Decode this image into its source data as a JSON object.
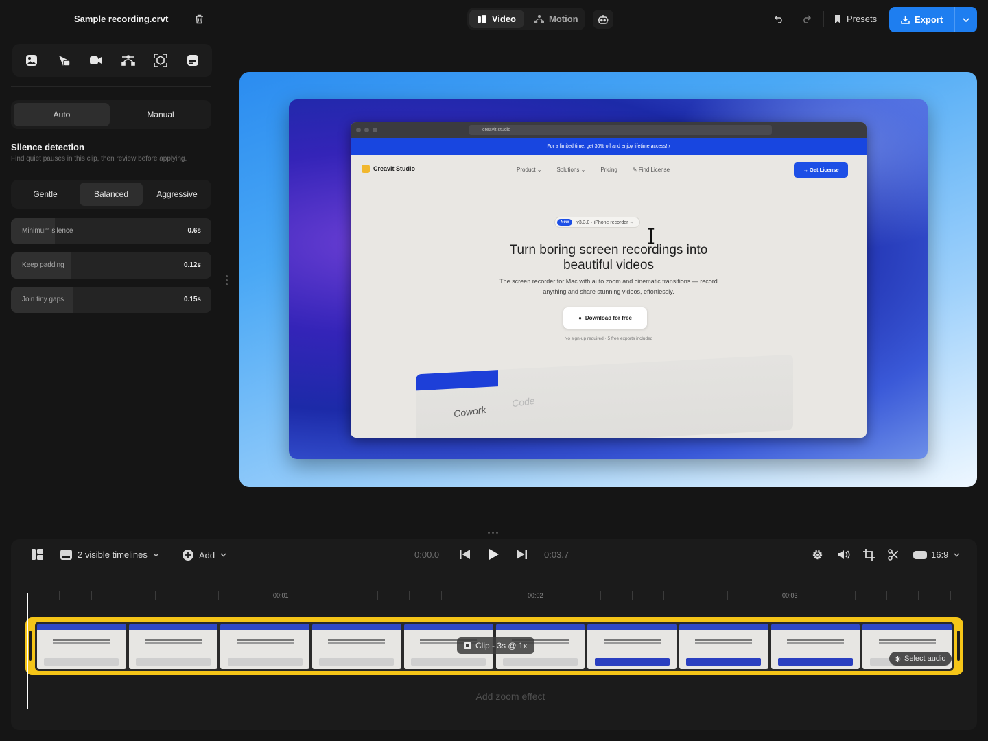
{
  "header": {
    "file_name": "Sample recording.crvt",
    "modes": [
      {
        "label": "Video",
        "active": true
      },
      {
        "label": "Motion",
        "active": false
      }
    ],
    "presets_label": "Presets",
    "export_label": "Export",
    "accent": "#1e7ef0"
  },
  "left_panel": {
    "tools": [
      "image-icon",
      "cursor-icon",
      "camera-icon",
      "bezier-icon",
      "webcam-icon",
      "captions-icon"
    ],
    "mode_tabs": [
      {
        "label": "Auto",
        "active": true
      },
      {
        "label": "Manual",
        "active": false
      }
    ],
    "section_title": "Silence detection",
    "section_subtitle": "Find quiet pauses in this clip, then review before applying.",
    "presets": [
      {
        "label": "Gentle",
        "active": false
      },
      {
        "label": "Balanced",
        "active": true
      },
      {
        "label": "Aggressive",
        "active": false
      }
    ],
    "sliders": [
      {
        "label": "Minimum silence",
        "value": "0.6s",
        "level": 0.22
      },
      {
        "label": "Keep padding",
        "value": "0.12s",
        "level": 0.3
      },
      {
        "label": "Join tiny gaps",
        "value": "0.15s",
        "level": 0.31
      }
    ]
  },
  "preview": {
    "url": "creavit.studio",
    "banner": "For a limited time, get 30% off and enjoy lifetime access! ›",
    "brand": "Creavit Studio",
    "nav": [
      "Product ⌄",
      "Solutions ⌄",
      "Pricing",
      "✎ Find License"
    ],
    "cta": "→ Get License",
    "pill_badge": "New",
    "pill_text": "v3.3.0 · iPhone recorder →",
    "headline_1": "Turn boring screen recordings into",
    "headline_2": "beautiful videos",
    "sub_1": "The screen recorder for Mac with auto zoom and cinematic transitions — record",
    "sub_2": "anything and share stunning videos, effortlessly.",
    "download": "Download for free",
    "fine_print": "No sign-up required · 5 free exports included",
    "mock_cowork": "Cowork",
    "mock_code": "Code"
  },
  "timeline": {
    "visible_timelines": "2 visible timelines",
    "add_label": "Add",
    "current_time": "0:00.0",
    "total_time": "0:03.7",
    "aspect": "16:9",
    "ruler_labels": [
      "00:01",
      "00:02",
      "00:03"
    ],
    "clip_label": "Clip - 3s @ 1x",
    "select_audio": "Select audio",
    "add_zoom": "Add zoom effect",
    "clip_color": "#f5c518"
  }
}
